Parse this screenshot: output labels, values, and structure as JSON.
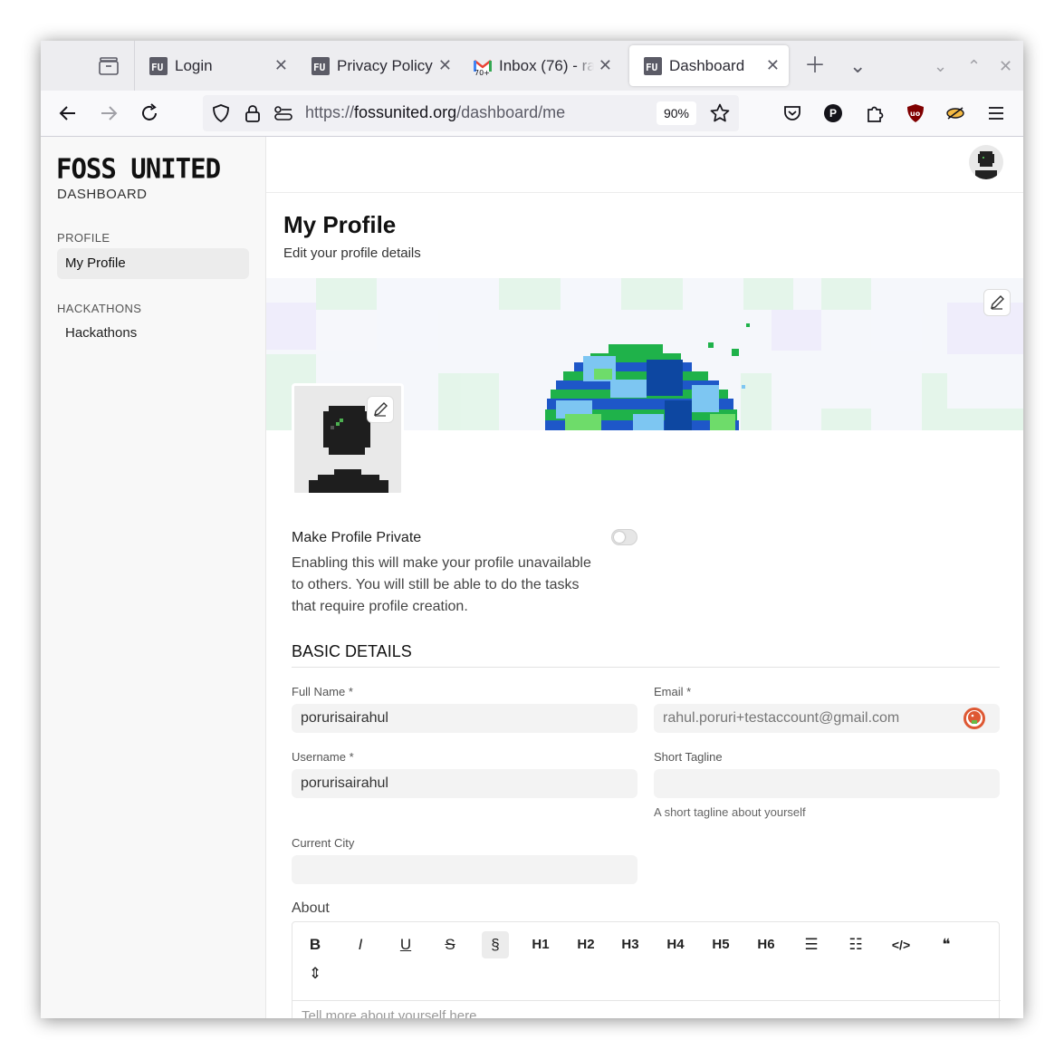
{
  "browser": {
    "tabs": [
      {
        "label": "Login",
        "favicon": "fu-logo"
      },
      {
        "label": "Privacy Policy",
        "favicon": "fu-logo"
      },
      {
        "label": "Inbox (76) - ra",
        "favicon": "gmail",
        "badge": "70+"
      },
      {
        "label": "Dashboard",
        "favicon": "fu-logo",
        "active": true
      }
    ],
    "url_scheme": "https://",
    "url_domain": "fossunited.org",
    "url_path": "/dashboard/me",
    "zoom": "90%",
    "profile_letter": "P"
  },
  "sidebar": {
    "logo": "FOSS UNITED",
    "subtitle": "DASHBOARD",
    "profile_section": "PROFILE",
    "profile_item": "My Profile",
    "hackathons_section": "HACKATHONS",
    "hackathons_item": "Hackathons"
  },
  "main": {
    "title": "My Profile",
    "subtitle": "Edit your profile details",
    "privacy": {
      "title": "Make Profile Private",
      "description": "Enabling this will make your profile unavailable to others. You will still be able to do the tasks that require profile creation.",
      "enabled": false
    },
    "basic_details": "BASIC DETAILS",
    "fields": {
      "full_name": {
        "label": "Full Name *",
        "value": "porurisairahul"
      },
      "email": {
        "label": "Email *",
        "value": "rahul.poruri+testaccount@gmail.com"
      },
      "username": {
        "label": "Username *",
        "value": "porurisairahul"
      },
      "tagline": {
        "label": "Short Tagline",
        "value": "",
        "hint": "A short tagline about yourself"
      },
      "city": {
        "label": "Current City",
        "value": ""
      }
    },
    "about": {
      "label": "About",
      "placeholder": "Tell more about yourself here",
      "toolbar": [
        {
          "label": "B",
          "name": "bold-button"
        },
        {
          "label": "I",
          "name": "italic-button"
        },
        {
          "label": "U",
          "name": "underline-button"
        },
        {
          "label": "S",
          "name": "strikethrough-button"
        },
        {
          "label": "§",
          "name": "paragraph-button"
        },
        {
          "label": "H1",
          "name": "heading-1-button"
        },
        {
          "label": "H2",
          "name": "heading-2-button"
        },
        {
          "label": "H3",
          "name": "heading-3-button"
        },
        {
          "label": "H4",
          "name": "heading-4-button"
        },
        {
          "label": "H5",
          "name": "heading-5-button"
        },
        {
          "label": "H6",
          "name": "heading-6-button"
        },
        {
          "label": "☰",
          "name": "bullet-list-button"
        },
        {
          "label": "☷",
          "name": "numbered-list-button"
        },
        {
          "label": "</>",
          "name": "code-button"
        },
        {
          "label": "❝",
          "name": "blockquote-button"
        },
        {
          "label": "⇕",
          "name": "horizontal-rule-button"
        }
      ]
    }
  },
  "colors": {
    "accent_green": "#1fb24a",
    "globe_blue": "#1e57c8",
    "globe_light_blue": "#7dc6f2"
  }
}
